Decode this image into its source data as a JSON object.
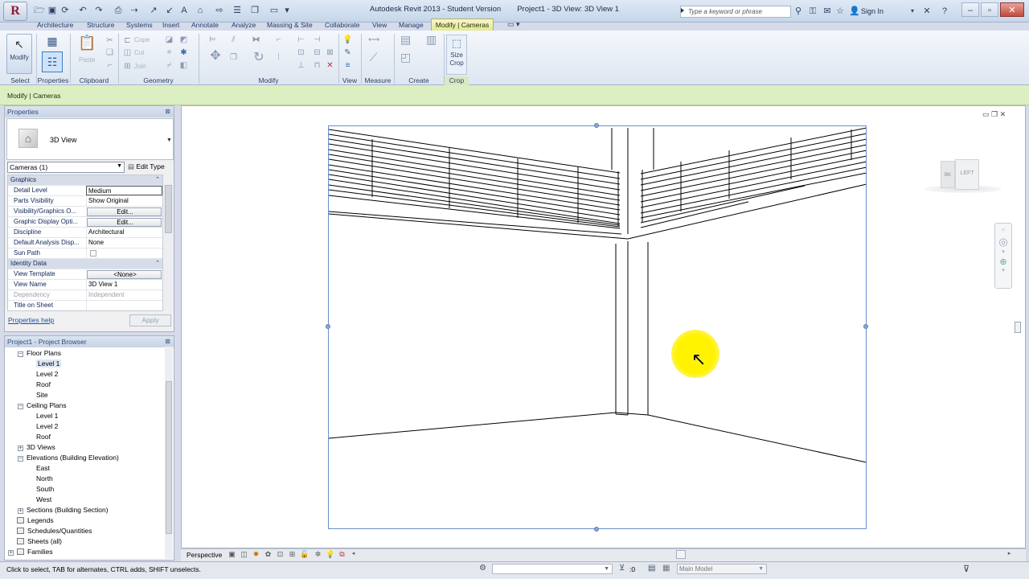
{
  "title_bar": {
    "app_title": "Autodesk Revit 2013 - Student Version",
    "doc_title": "Project1 - 3D View: 3D View 1",
    "search_placeholder": "Type a keyword or phrase",
    "sign_in": "Sign In"
  },
  "tabs": [
    "Architecture",
    "Structure",
    "Systems",
    "Insert",
    "Annotate",
    "Analyze",
    "Massing & Site",
    "Collaborate",
    "View",
    "Manage"
  ],
  "active_tab": "Modify | Cameras",
  "ribbon": {
    "modify_label": "Modify",
    "paste_label": "Paste",
    "cope_label": "Cope",
    "cut_label": "Cut",
    "join_label": "Join",
    "size_crop_label": "Size Crop",
    "panels": [
      "Select",
      "Properties",
      "Clipboard",
      "Geometry",
      "Modify",
      "View",
      "Measure",
      "Create",
      "Crop"
    ]
  },
  "contextual_label": "Modify | Cameras",
  "properties": {
    "title": "Properties",
    "type_name": "3D View",
    "instance_filter": "Cameras (1)",
    "edit_type": "Edit Type",
    "rows": [
      {
        "k": "Graphics",
        "v": "",
        "group": true
      },
      {
        "k": "Detail Level",
        "v": "Medium",
        "input": true
      },
      {
        "k": "Parts Visibility",
        "v": "Show Original"
      },
      {
        "k": "Visibility/Graphics O...",
        "v": "Edit...",
        "btn": true
      },
      {
        "k": "Graphic Display Opti...",
        "v": "Edit...",
        "btn": true
      },
      {
        "k": "Discipline",
        "v": "Architectural"
      },
      {
        "k": "Default Analysis Disp...",
        "v": "None"
      },
      {
        "k": "Sun Path",
        "v": "",
        "check": true
      },
      {
        "k": "Identity Data",
        "v": "",
        "group": true
      },
      {
        "k": "View Template",
        "v": "<None>",
        "btn": true
      },
      {
        "k": "View Name",
        "v": "3D View 1"
      },
      {
        "k": "Dependency",
        "v": "Independent",
        "grey": true
      },
      {
        "k": "Title on Sheet",
        "v": ""
      }
    ],
    "help": "Properties help",
    "apply": "Apply"
  },
  "browser": {
    "title": "Project1 - Project Browser",
    "items": [
      {
        "label": "Floor Plans",
        "indent": 1,
        "box": "−"
      },
      {
        "label": "Level 1",
        "indent": 2,
        "selected": true
      },
      {
        "label": "Level 2",
        "indent": 2
      },
      {
        "label": "Roof",
        "indent": 2
      },
      {
        "label": "Site",
        "indent": 2
      },
      {
        "label": "Ceiling Plans",
        "indent": 1,
        "box": "−"
      },
      {
        "label": "Level 1",
        "indent": 2
      },
      {
        "label": "Level 2",
        "indent": 2
      },
      {
        "label": "Roof",
        "indent": 2
      },
      {
        "label": "3D Views",
        "indent": 1,
        "box": "+"
      },
      {
        "label": "Elevations (Building Elevation)",
        "indent": 1,
        "box": "−"
      },
      {
        "label": "East",
        "indent": 2
      },
      {
        "label": "North",
        "indent": 2
      },
      {
        "label": "South",
        "indent": 2
      },
      {
        "label": "West",
        "indent": 2
      },
      {
        "label": "Sections (Building Section)",
        "indent": 1,
        "box": "+"
      },
      {
        "label": "Legends",
        "indent": 0,
        "icon": true
      },
      {
        "label": "Schedules/Quantities",
        "indent": 0,
        "icon": true
      },
      {
        "label": "Sheets (all)",
        "indent": 0,
        "icon": true
      },
      {
        "label": "Families",
        "indent": 0,
        "box": "+",
        "icon": true
      }
    ]
  },
  "viewcube": {
    "left": "LEFT",
    "corner": "BK"
  },
  "view_control": {
    "projection": "Perspective"
  },
  "status": {
    "text": "Click to select, TAB for alternates, CTRL adds, SHIFT unselects.",
    "selection_count": ":0",
    "model": "Main Model"
  }
}
